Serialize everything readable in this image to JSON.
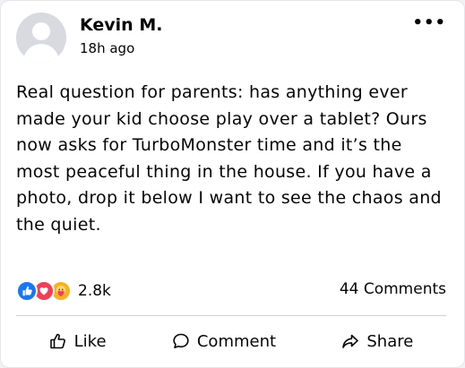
{
  "post": {
    "author": "Kevin M.",
    "time": "18h ago",
    "more_label": "•••",
    "text": "Real question for parents: has anything ever made your kid choose play over a tablet? Ours now asks for TurboMonster time and it’s the most peaceful thing in the house. If you have a photo, drop it below I want to see the chaos and the quiet.",
    "reaction_icons": [
      "like-icon",
      "love-icon",
      "care-icon"
    ],
    "reaction_count": "2.8k",
    "comment_count": "44 Comments"
  },
  "actions": {
    "like": "Like",
    "comment": "Comment",
    "share": "Share"
  },
  "colors": {
    "like": "#1877f2",
    "love": "#f33e58",
    "care": "#f7b125",
    "text": "#050505"
  }
}
